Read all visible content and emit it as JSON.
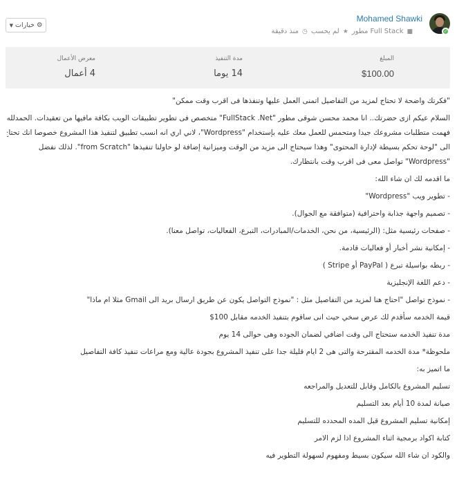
{
  "header": {
    "user_name": "Mohamed Shawki",
    "specialty": "Full Stack مطور",
    "hire_status": "لم يحسب",
    "time_ago": "منذ دقيقة",
    "options_label": "خيارات"
  },
  "stats": {
    "budget_label": "المبلغ",
    "budget_value": "$100.00",
    "duration_label": "مدة التنفيذ",
    "duration_value": "14 يوما",
    "portfolio_label": "معرض الأعمال",
    "portfolio_value": "4 أعمال"
  },
  "proposal": {
    "lines": [
      "\"فكرتك واضحة لا تحتاج لمزيد من التفاصيل اتمنى العمل عليها وتنفذها فى اقرب وقت ممكن\"",
      "السلام عيكم ازى حضرتك.. انا محمد محسن شوقى مطور \"FullStack .Net\" متخصص فى تطوير تطبيقات الويب بكافة مافيها من تعقيدات. الحمدلله",
      "فهمت متطلبات مشروعك جيدا ومتحمس للعمل معك عليه بإستخدام \"Wordpress\"، لاني اري انه انسب تطبيق لتنفيذ هذا المشروع خصوصا انك تحتاج",
      "الى \"لوحة تحكم بسيطة لإدارة المحتوى\" وهذا سيحتاج الى مزيد من الوقت وميزانية إضافة لو حاولنا تنفيذها \"from Scratch\". لذلك نفضل",
      "\"Wordpress\" تواصل معى فى اقرب وقت بانتظارك.",
      "ما اقدمه لك ان شاء الله:",
      "- تطوير ويب \"Wordpress\"",
      "- تصميم واجهة جذابة واحترافية (متوافقة مع الجوال).",
      "- صفحات رئيسية مثل: (الرئيسية، من نحن، الخدمات/المبادرات، التبرع، الفعاليات، تواصل معنا).",
      "- إمكانية نشر أخبار أو فعاليات قادمة.",
      "- ربطه بواسيلة تبرع ( PayPal أو Stripe )",
      "- دعم اللغة الإنجليزية",
      "- نموذج تواصل \"احتاج هنا لمزيد من التفاصيل مثل : \"نموذج التواصل يكون عن طريق ارسال بريد الى Gmail مثلا ام ماذا\"",
      "قيمة الخدمه سأقدم لك عرض سخي حيث انى ساقوم بتنفيذ الخدمه مقابل 100$",
      "مدة تنفيذ الخدمه ستحتاج الى وقت اضافي لضمان الجوده وهى حوالى 14 يوم",
      "ملحوظة* مدة الخدمه المقترحة والتى هى 2 ايام قليلة جدا على تنفيذ المشروع بجودة عالية ومع مراعات تنفيذ كافة التفاصيل",
      "ما اتميز به:",
      "تسليم المشروع بالكامل وقابل للتعديل والمراجعه",
      "صيانة لمدة 10 أيام بعد التسليم",
      "إمكانية تسليم المشروع قبل المده المحدده للتسليم",
      "كتابة اكواد برمجية اثناء المشروع اذا لزم الامر",
      "والكود ان شاء الله سيكون بسيط ومفهوم لسهولة التطوير فيه"
    ]
  }
}
